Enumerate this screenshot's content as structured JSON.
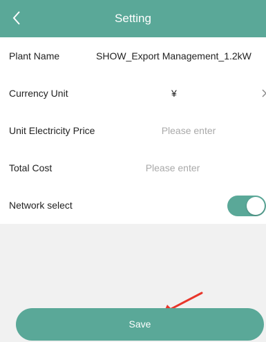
{
  "header": {
    "title": "Setting"
  },
  "form": {
    "plant_name": {
      "label": "Plant Name",
      "value": "SHOW_Export Management_1.2kW"
    },
    "currency_unit": {
      "label": "Currency Unit",
      "value": "¥"
    },
    "unit_price": {
      "label": "Unit Electricity Price",
      "placeholder": "Please enter"
    },
    "total_cost": {
      "label": "Total Cost",
      "placeholder": "Please enter"
    },
    "network_select": {
      "label": "Network select",
      "enabled": true
    }
  },
  "footer": {
    "save_label": "Save"
  },
  "colors": {
    "accent": "#5aa898",
    "annotation_arrow": "#e8362b"
  },
  "icons": {
    "back": "chevron-left-icon",
    "currency_more": "chevron-right-icon"
  }
}
